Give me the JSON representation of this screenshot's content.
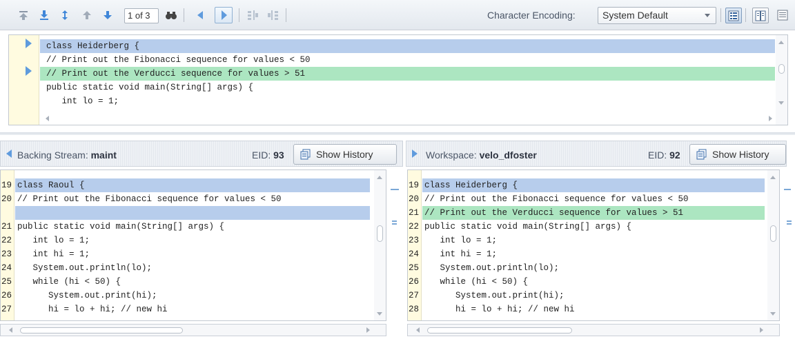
{
  "toolbar": {
    "page_indicator": "1 of 3",
    "encoding_label": "Character Encoding:",
    "encoding_value": "System Default",
    "icons": [
      "first-diff-icon",
      "download-icon",
      "expand-icon",
      "prev-diff-icon",
      "next-diff-icon",
      "binoculars-icon",
      "prev-change-icon",
      "next-change-icon",
      "merge-left-icon",
      "merge-right-icon",
      "view-unified-icon",
      "view-side-by-side-icon",
      "view-list-icon"
    ]
  },
  "top_pane": {
    "lines": [
      {
        "text": "class Heiderberg {",
        "highlight": "blue"
      },
      {
        "text": "// Print out the Fibonacci sequence for values < 50",
        "highlight": "none"
      },
      {
        "text": "// Print out the Verducci sequence for values > 51",
        "highlight": "green"
      },
      {
        "text": "public static void main(String[] args) {",
        "highlight": "none"
      },
      {
        "text": "   int lo = 1;",
        "highlight": "none"
      }
    ]
  },
  "left_pane": {
    "label": "Backing Stream:",
    "name": "maint",
    "eid_label": "EID:",
    "eid_value": "93",
    "history_button": "Show History",
    "lines": [
      {
        "num": "19",
        "text": "class Raoul {",
        "highlight": "blue"
      },
      {
        "num": "20",
        "text": "// Print out the Fibonacci sequence for values < 50",
        "highlight": "none"
      },
      {
        "num": "",
        "text": "",
        "highlight": "blue"
      },
      {
        "num": "21",
        "text": "public static void main(String[] args) {",
        "highlight": "none"
      },
      {
        "num": "22",
        "text": "   int lo = 1;",
        "highlight": "none"
      },
      {
        "num": "23",
        "text": "   int hi = 1;",
        "highlight": "none"
      },
      {
        "num": "24",
        "text": "   System.out.println(lo);",
        "highlight": "none"
      },
      {
        "num": "25",
        "text": "   while (hi < 50) {",
        "highlight": "none"
      },
      {
        "num": "26",
        "text": "      System.out.print(hi);",
        "highlight": "none"
      },
      {
        "num": "27",
        "text": "      hi = lo + hi; // new hi",
        "highlight": "none"
      }
    ]
  },
  "right_pane": {
    "label": "Workspace:",
    "name": "velo_dfoster",
    "eid_label": "EID:",
    "eid_value": "92",
    "history_button": "Show History",
    "lines": [
      {
        "num": "19",
        "text": "class Heiderberg {",
        "highlight": "blue"
      },
      {
        "num": "20",
        "text": "// Print out the Fibonacci sequence for values < 50",
        "highlight": "none"
      },
      {
        "num": "21",
        "text": "// Print out the Verducci sequence for values > 51",
        "highlight": "green"
      },
      {
        "num": "22",
        "text": "public static void main(String[] args) {",
        "highlight": "none"
      },
      {
        "num": "23",
        "text": "   int lo = 1;",
        "highlight": "none"
      },
      {
        "num": "24",
        "text": "   int hi = 1;",
        "highlight": "none"
      },
      {
        "num": "25",
        "text": "   System.out.println(lo);",
        "highlight": "none"
      },
      {
        "num": "26",
        "text": "   while (hi < 50) {",
        "highlight": "none"
      },
      {
        "num": "27",
        "text": "      System.out.print(hi);",
        "highlight": "none"
      },
      {
        "num": "28",
        "text": "      hi = lo + hi; // new hi",
        "highlight": "none"
      }
    ]
  },
  "colors": {
    "diff_blue": "#b7cdec",
    "diff_green": "#ace6c1",
    "gutter": "#fffbe0",
    "accent": "#5f9bdd"
  }
}
